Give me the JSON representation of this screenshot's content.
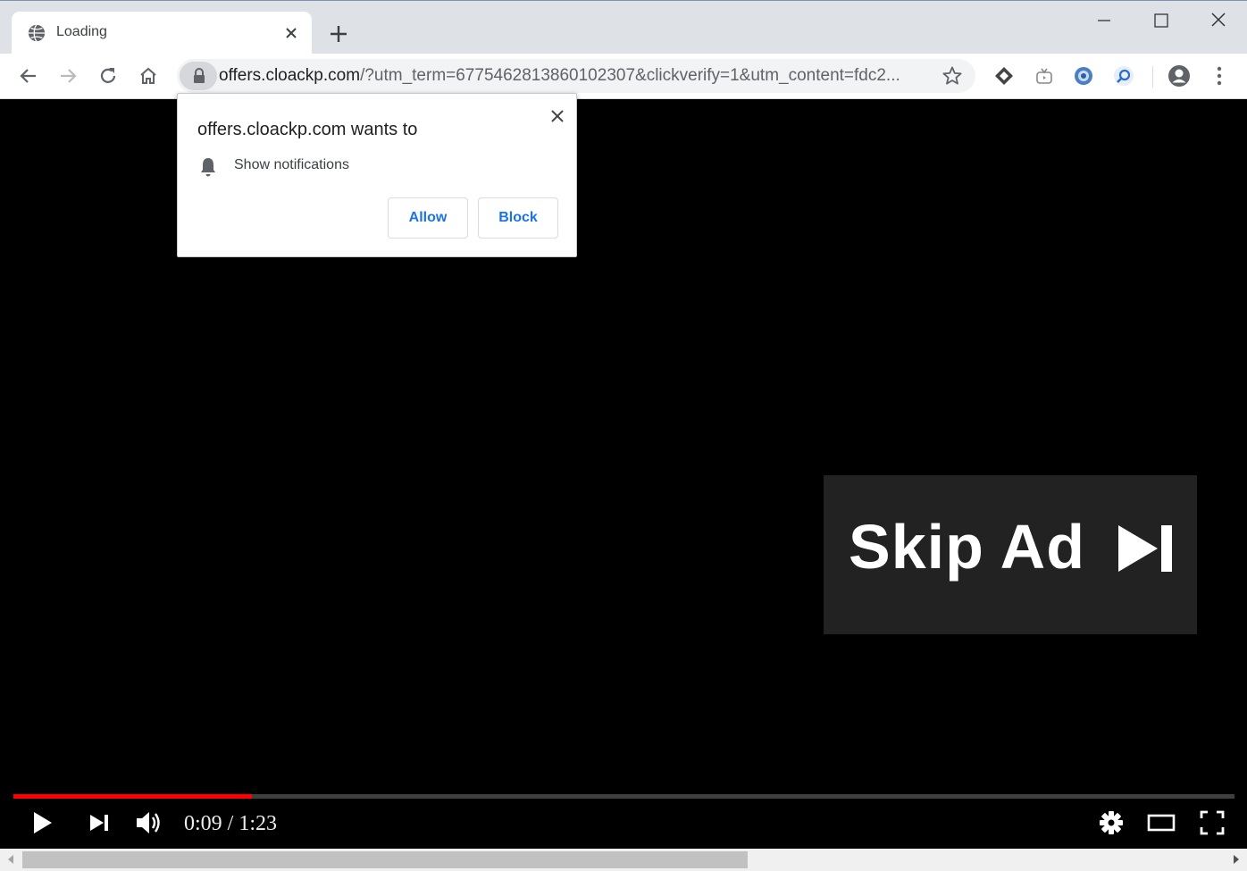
{
  "tab": {
    "title": "Loading"
  },
  "toolbar": {
    "url_host": "offers.cloackp.com",
    "url_rest": "/?utm_term=6775462813860102307&clickverify=1&utm_content=fdc2..."
  },
  "popup": {
    "title": "offers.cloackp.com wants to",
    "permission": "Show notifications",
    "allow_label": "Allow",
    "block_label": "Block"
  },
  "video": {
    "skip_label": "Skip Ad",
    "time": "0:09 / 1:23",
    "progress": 0.195,
    "progress_color": "#ff0000"
  },
  "icons": {
    "tab": [
      "globe-icon",
      "close-icon",
      "plus-icon"
    ],
    "window": [
      "minimize-icon",
      "maximize-icon",
      "close-icon"
    ],
    "toolbar": [
      "back-icon",
      "forward-icon",
      "reload-icon",
      "home-icon",
      "lock-icon",
      "star-icon",
      "extension-icons",
      "profile-icon",
      "menu-icon"
    ],
    "player": [
      "play-icon",
      "next-icon",
      "volume-icon",
      "settings-icon",
      "theater-icon",
      "fullscreen-icon"
    ]
  }
}
